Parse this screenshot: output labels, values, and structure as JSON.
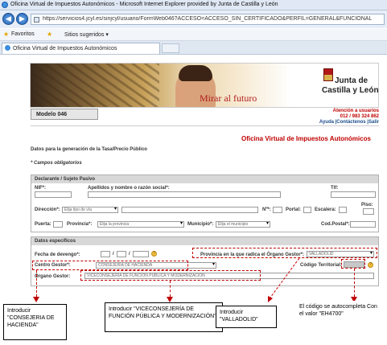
{
  "browser": {
    "title": "Oficina Virtual de Impuestos Autonómicos - Microsoft Internet Explorer provided by Junta de Castilla y León",
    "url": "https://servicios4.jcyl.es/sinjcyl/usuario/FormWeb046?ACCESO=ACCESO_SIN_CERTIFICADO&PERFIL=GENERAL&FUNCIONAL",
    "favorites_label": "Favoritos",
    "suggested_sites": "Sitios sugeridos ▾",
    "tab_title": "Oficina Virtual de Impuestos Autonómicos"
  },
  "banner": {
    "slogan": "Mirar al futuro",
    "logo_line1": "Junta de",
    "logo_line2": "Castilla y León"
  },
  "header": {
    "modelo": "Modelo 046",
    "atencion": "Atención a usuarios",
    "phone": "012 / 983 324 862",
    "links": "Ayuda |Contáctenos |Salir"
  },
  "page": {
    "office_title": "Oficina Virtual de Impuestos Autonómicos",
    "section_title": "Datos para la generación de la Tasa/Precio Público",
    "required_note": "* Campos obligatorios"
  },
  "declarante": {
    "heading": "Declarante / Sujeto Pasivo",
    "nif_label": "NIF*:",
    "nombre_label": "Apellidos y nombre o razón social*:",
    "tlf_label": "Tlf:",
    "direccion_label": "Dirección*:",
    "tipo_via_placeholder": "Elija tipo de vía",
    "num_label": "Nº*:",
    "portal_label": "Portal:",
    "escalera_label": "Escalera:",
    "piso_label": "Piso:",
    "puerta_label": "Puerta:",
    "provincia_label": "Provincia*:",
    "provincia_placeholder": "Elija la provincia",
    "municipio_label": "Municipio*:",
    "municipio_placeholder": "Elija el municipio",
    "cp_label": "Cod.Postal*:"
  },
  "especificos": {
    "heading": "Datos específicos",
    "fecha_label": "Fecha de devengo*:",
    "provincia_gestor_label": "Provincia en la que radica el Órgano Gestor*:",
    "provincia_gestor_value": "VALLADOLID",
    "centro_label": "Centro Gestor*:",
    "centro_value": "CONSEJERÍA DE HACIENDA",
    "codigo_label": "Código Territorial:",
    "organo_label": "Órgano Gestor:",
    "organo_value": "VICECONSEJERÍA DE FUNCIÓN PÚBLICA Y MODERNIZACIÓN"
  },
  "annotations": {
    "c1": "Introducir \"CONSEJERIA DE HACIENDA\"",
    "c2": "Introducir \"VICECONSEJERÍA DE FUNCIÓN PÚBLICA Y MODERNIZACIÓN\"",
    "c3": "Introducir \"VALLADOLID\"",
    "c4": "El código se autocompleta Con el valor \"EH4700\""
  }
}
